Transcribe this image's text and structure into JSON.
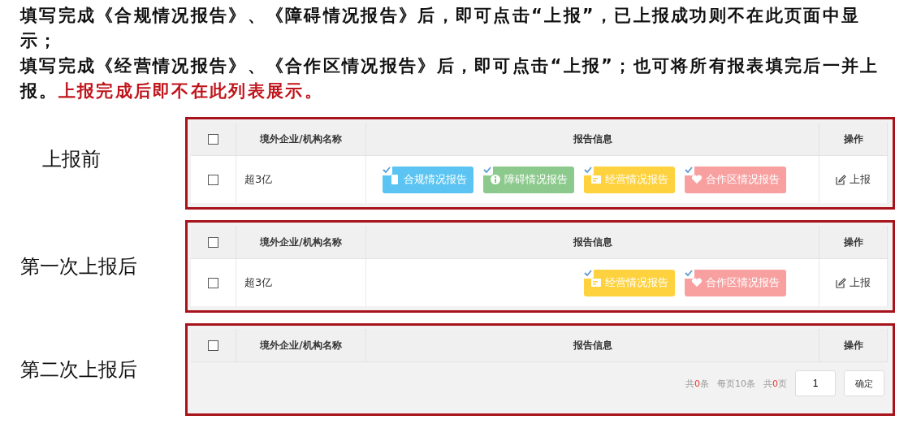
{
  "intro": [
    {
      "text": "填写完成《合规情况报告》、《障碍情况报告》后，即可点击“上报”，已上报成功则不在此页面中显示；"
    },
    {
      "text": "填写完成《经营情况报告》、《合作区情况报告》后，即可点击“上报”；也可将所有报表填完后一并上报。",
      "note": "上报完成后即不在此列表展示。"
    }
  ],
  "stages": [
    {
      "label": "上报前",
      "table": {
        "columns": [
          "境外企业/机构名称",
          "报告信息",
          "操作"
        ],
        "header_checked": false,
        "rows": [
          {
            "checked": false,
            "name": "超3亿",
            "action": "上报",
            "reports": [
              {
                "label": "合规情况报告",
                "kind": "doc",
                "color": "#5bc4f2",
                "done": true
              },
              {
                "label": "障碍情况报告",
                "kind": "info",
                "color": "#8cc98c",
                "done": true
              },
              {
                "label": "经营情况报告",
                "kind": "form",
                "color": "#fdd23e",
                "done": true
              },
              {
                "label": "合作区情况报告",
                "kind": "heart",
                "color": "#f8a0a0",
                "done": true
              }
            ]
          }
        ]
      }
    },
    {
      "label": "第一次上报后",
      "table": {
        "columns": [
          "境外企业/机构名称",
          "报告信息",
          "操作"
        ],
        "header_checked": false,
        "rows": [
          {
            "checked": false,
            "name": "超3亿",
            "action": "上报",
            "reports": [
              {
                "label": "经营情况报告",
                "kind": "form",
                "color": "#fdd23e",
                "done": true
              },
              {
                "label": "合作区情况报告",
                "kind": "heart",
                "color": "#f8a0a0",
                "done": true
              }
            ]
          }
        ]
      }
    },
    {
      "label": "第二次上报后",
      "table": {
        "columns": [
          "境外企业/机构名称",
          "报告信息",
          "操作"
        ],
        "header_checked": false,
        "pagination": {
          "total": {
            "prefix": "共",
            "count": "0",
            "suffix": "条"
          },
          "page_size": "每页10条",
          "pages": {
            "prefix": "共",
            "count": "0",
            "suffix": "页"
          },
          "page_input": "1",
          "confirm": "确定"
        }
      }
    }
  ]
}
